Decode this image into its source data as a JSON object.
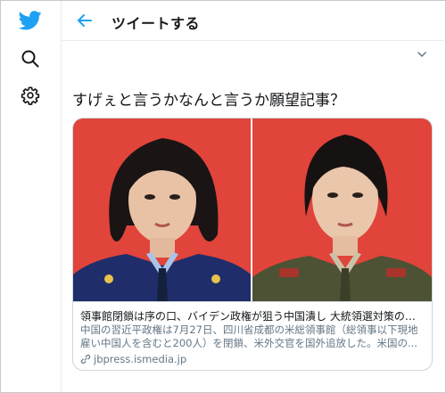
{
  "header": {
    "title": "ツイートする"
  },
  "tweet": {
    "text": "すげぇと言うかなんと言うか願望記事？"
  },
  "card": {
    "title": "領事館閉鎖は序の口、バイデン政権が狙う中国潰し 大統領選対策のト...",
    "description_line1": "中国の習近平政権は7月27日、四川省成都の米総領事館（総領事以下現地",
    "description_line2": "雇い中国人を含むと200人）を閉鎖、米外交官を国外追放した。米国の...",
    "domain": "jbpress.ismedia.jp"
  },
  "colors": {
    "brand": "#1da1f2",
    "photo_bg": "#e0443a"
  },
  "icons": [
    "twitter-logo-icon",
    "search-icon",
    "settings-gear-icon",
    "back-arrow-icon",
    "chevron-down-icon",
    "link-icon"
  ]
}
